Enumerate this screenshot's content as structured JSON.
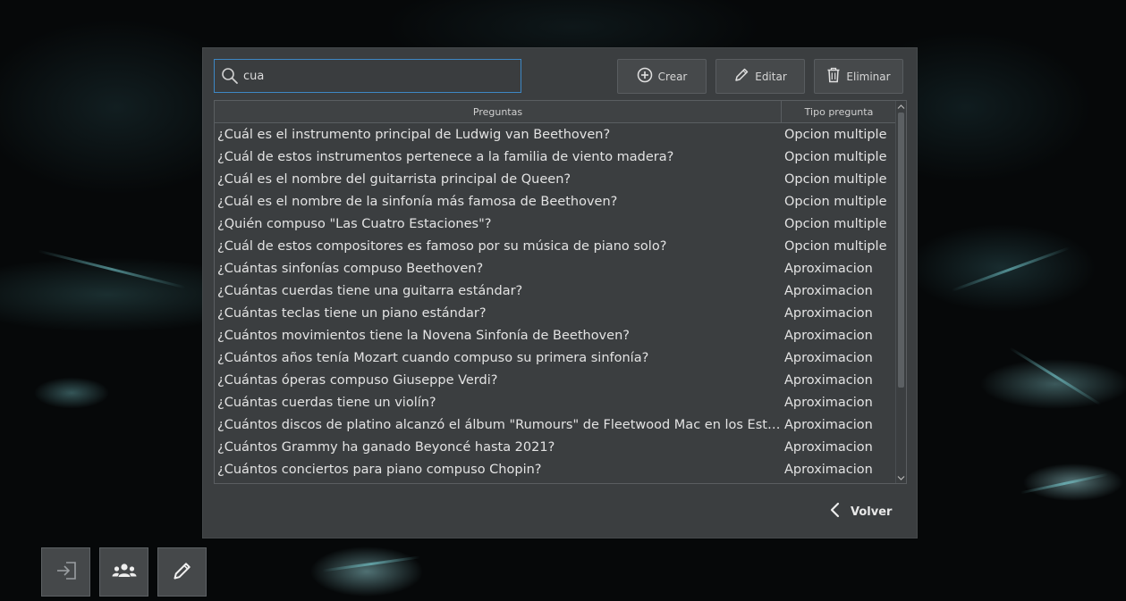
{
  "search": {
    "value": "cua",
    "icon": "search-icon"
  },
  "toolbar": {
    "create_label": "Crear",
    "create_icon": "plus-circle-icon",
    "edit_label": "Editar",
    "edit_icon": "pencil-icon",
    "delete_label": "Eliminar",
    "delete_icon": "trash-icon"
  },
  "table": {
    "columns": [
      "Preguntas",
      "Tipo pregunta"
    ],
    "rows": [
      {
        "pregunta": "¿Cuál es el instrumento principal de Ludwig van Beethoven?",
        "tipo": "Opcion multiple"
      },
      {
        "pregunta": "¿Cuál de estos instrumentos pertenece a la familia de viento madera?",
        "tipo": "Opcion multiple"
      },
      {
        "pregunta": "¿Cuál es el nombre del guitarrista principal de Queen?",
        "tipo": "Opcion multiple"
      },
      {
        "pregunta": "¿Cuál es el nombre de la sinfonía más famosa de Beethoven?",
        "tipo": "Opcion multiple"
      },
      {
        "pregunta": "¿Quién compuso \"Las Cuatro Estaciones\"?",
        "tipo": "Opcion multiple"
      },
      {
        "pregunta": "¿Cuál de estos compositores es famoso por su música de piano solo?",
        "tipo": "Opcion multiple"
      },
      {
        "pregunta": "¿Cuántas sinfonías compuso Beethoven?",
        "tipo": "Aproximacion"
      },
      {
        "pregunta": "¿Cuántas cuerdas tiene una guitarra estándar?",
        "tipo": "Aproximacion"
      },
      {
        "pregunta": "¿Cuántas teclas tiene un piano estándar?",
        "tipo": "Aproximacion"
      },
      {
        "pregunta": "¿Cuántos movimientos tiene la Novena Sinfonía de Beethoven?",
        "tipo": "Aproximacion"
      },
      {
        "pregunta": "¿Cuántos años tenía Mozart cuando compuso su primera sinfonía?",
        "tipo": "Aproximacion"
      },
      {
        "pregunta": "¿Cuántas óperas compuso Giuseppe Verdi?",
        "tipo": "Aproximacion"
      },
      {
        "pregunta": "¿Cuántas cuerdas tiene un violín?",
        "tipo": "Aproximacion"
      },
      {
        "pregunta": "¿Cuántos discos de platino alcanzó el álbum \"Rumours\" de Fleetwood Mac en los Estad...",
        "tipo": "Aproximacion"
      },
      {
        "pregunta": "¿Cuántos Grammy ha ganado Beyoncé hasta 2021?",
        "tipo": "Aproximacion"
      },
      {
        "pregunta": "¿Cuántos conciertos para piano compuso Chopin?",
        "tipo": "Aproximacion"
      }
    ]
  },
  "footer": {
    "back_label": "Volver",
    "back_icon": "chevron-left-icon"
  },
  "bottom_bar": {
    "login_icon": "login-icon",
    "users_icon": "users-group-icon",
    "edit_icon": "pencil-icon"
  },
  "colors": {
    "panel_bg": "#3b3e40",
    "search_focus_border": "#3d87c4",
    "text": "#e3e3e3"
  }
}
